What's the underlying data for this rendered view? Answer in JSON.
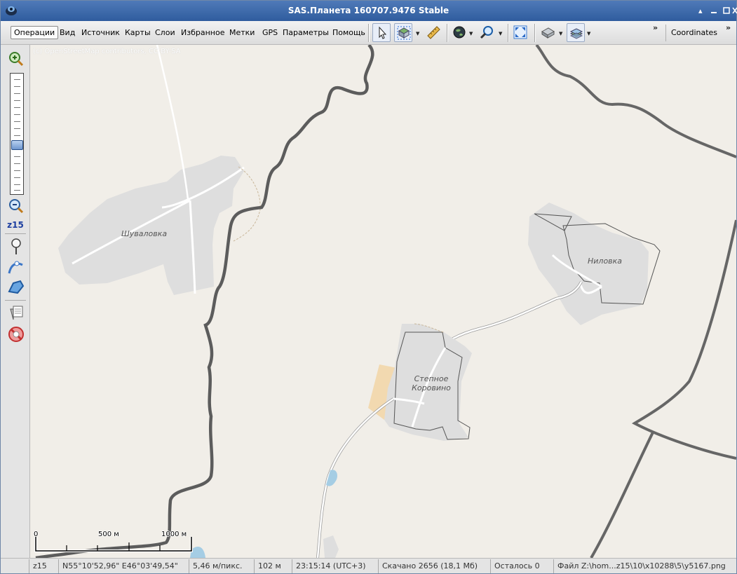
{
  "window": {
    "title": "SAS.Планета 160707.9476 Stable"
  },
  "menu": {
    "items": [
      "Операции",
      "Вид",
      "Источник",
      "Карты",
      "Слои",
      "Избранное",
      "Метки",
      "GPS",
      "Параметры",
      "Помощь"
    ]
  },
  "toolbar": {
    "coordinates_label": "Coordinates",
    "overflow_glyph": "»"
  },
  "leftbar": {
    "zoom_level": "z15",
    "zoom_fraction": 0.6
  },
  "map": {
    "attribution": "(c) OpenStreetMap contributors, CC-BY-SA",
    "labels": {
      "shuvalovka": "Шуваловка",
      "nilovka": "Ниловка",
      "stepnoe": "Степное Коровино"
    },
    "scale": {
      "zero": "0",
      "mid": "500 м",
      "end": "1000 м"
    }
  },
  "colors": {
    "map_background": "#f1eee8",
    "settlement": "#dedede",
    "river": "#5c5c5c",
    "boundary": "#666666",
    "farmland": "#f2d9b0",
    "water": "#a5cde4"
  },
  "statusbar": {
    "zoom": "z15",
    "coords": "N55°10'52,96\" E46°03'49,54\"",
    "resolution": "5,46 м/пикс.",
    "elevation": "102 м",
    "time": "23:15:14 (UTC+3)",
    "downloaded": "Скачано 2656 (18,1 Мб)",
    "remaining": "Осталось 0",
    "file": "Файл Z:\\hom...z15\\10\\x10288\\5\\y5167.png"
  }
}
